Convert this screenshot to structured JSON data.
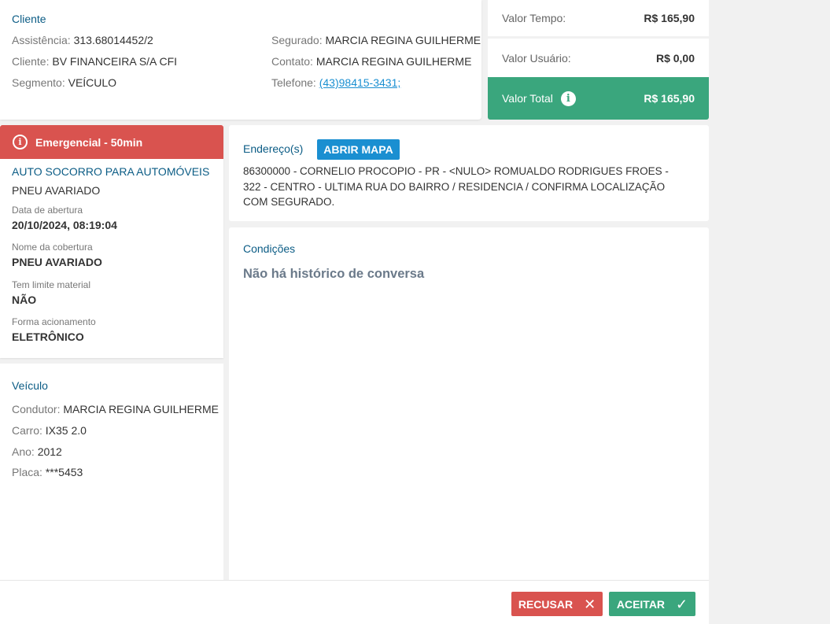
{
  "cliente": {
    "title": "Cliente",
    "assistencia_label": "Assistência:",
    "assistencia_value": "313.68014452/2",
    "cliente_label": "Cliente:",
    "cliente_value": "BV FINANCEIRA S/A CFI",
    "segmento_label": "Segmento:",
    "segmento_value": "VEÍCULO",
    "segurado_label": "Segurado:",
    "segurado_value": "MARCIA REGINA GUILHERME",
    "contato_label": "Contato:",
    "contato_value": "MARCIA REGINA GUILHERME",
    "telefone_label": "Telefone:",
    "telefone_value": "(43)98415-3431;"
  },
  "valores": {
    "tempo_label": "Valor Tempo:",
    "tempo_value": "R$ 165,90",
    "usuario_label": "Valor Usuário:",
    "usuario_value": "R$ 0,00",
    "total_label": "Valor Total",
    "total_value": "R$ 165,90",
    "info_icon": "info-icon"
  },
  "servico": {
    "banner": "Emergencial - 50min",
    "banner_icon": "alert-circle-icon",
    "service_name": "AUTO SOCORRO PARA AUTOMÓVEIS",
    "service_sub": "PNEU AVARIADO",
    "data_abertura_label": "Data de abertura",
    "data_abertura_value": "20/10/2024, 08:19:04",
    "cobertura_label": "Nome da cobertura",
    "cobertura_value": "PNEU AVARIADO",
    "limite_label": "Tem limite material",
    "limite_value": "NÃO",
    "acionamento_label": "Forma acionamento",
    "acionamento_value": "ELETRÔNICO"
  },
  "veiculo": {
    "title": "Veículo",
    "condutor_label": "Condutor:",
    "condutor_value": "MARCIA REGINA GUILHERME",
    "carro_label": "Carro:",
    "carro_value": "IX35 2.0",
    "ano_label": "Ano:",
    "ano_value": "2012",
    "placa_label": "Placa:",
    "placa_value": "***5453"
  },
  "endereco": {
    "title": "Endereço(s)",
    "map_button": "ABRIR MAPA",
    "address": "86300000 - CORNELIO PROCOPIO - PR - <NULO> ROMUALDO RODRIGUES FROES - 322 - CENTRO - ULTIMA RUA DO BAIRRO / RESIDENCIA / CONFIRMA LOCALIZAÇÃO COM SEGURADO."
  },
  "condicoes": {
    "title": "Condições",
    "empty_message": "Não há histórico de conversa"
  },
  "footer": {
    "reject_label": "RECUSAR",
    "reject_icon": "close-icon",
    "accept_label": "ACEITAR",
    "accept_icon": "check-icon"
  },
  "colors": {
    "accent_blue": "#1a8fd1",
    "title_blue": "#0b5c85",
    "danger_red": "#d9534f",
    "success_green": "#3aa67d"
  }
}
